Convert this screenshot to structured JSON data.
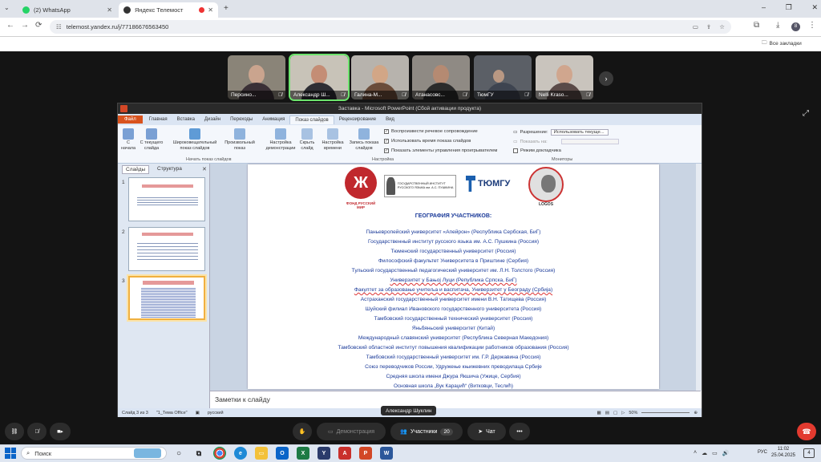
{
  "browser": {
    "tabs": [
      {
        "label": "(2) WhatsApp",
        "active": false
      },
      {
        "label": "Яндекс Телемост",
        "active": true
      }
    ],
    "url": "telemost.yandex.ru/j/77186676563450",
    "bookmarks_label": "Все закладки"
  },
  "meeting": {
    "participants": [
      {
        "name": "Персино...",
        "speaking": false
      },
      {
        "name": "Александр Ш...",
        "speaking": true
      },
      {
        "name": "Галина-М...",
        "speaking": false
      },
      {
        "name": "Атанасовс...",
        "speaking": false
      },
      {
        "name": "ТюмГУ",
        "speaking": false
      },
      {
        "name": "Nelli Kraso...",
        "speaking": false
      }
    ],
    "presenter_label": "Александр Шуклин",
    "controls": {
      "demo_label": "Демонстрация",
      "participants_label": "Участники",
      "participants_count": "20",
      "chat_label": "Чат"
    }
  },
  "ppt": {
    "title": "Заставка - Microsoft PowerPoint (Сбой активации продукта)",
    "tabs": [
      "Файл",
      "Главная",
      "Вставка",
      "Дизайн",
      "Переходы",
      "Анимация",
      "Показ слайдов",
      "Рецензирование",
      "Вид"
    ],
    "active_tab": "Показ слайдов",
    "ribbon": {
      "buttons": [
        {
          "label": "С начала"
        },
        {
          "label": "С текущего слайда"
        },
        {
          "label": "Широковещательный показ слайдов"
        },
        {
          "label": "Произвольный показ"
        },
        {
          "label": "Настройка демонстрации"
        },
        {
          "label": "Скрыть слайд"
        },
        {
          "label": "Настройка времени"
        },
        {
          "label": "Запись показа слайдов"
        }
      ],
      "group_start": "Начать показ слайдов",
      "group_setup": "Настройка",
      "group_monitors": "Мониторы",
      "checks": [
        "Воспроизвести речевое сопровождение",
        "Использовать время показа слайдов",
        "Показать элементы управления проигрывателем"
      ],
      "resolution_label": "Разрешение:",
      "resolution_value": "Использовать текуще...",
      "show_on_label": "Показать на:",
      "presenter_view_label": "Режим докладчика"
    },
    "pane_tabs": [
      "Слайды",
      "Структура"
    ],
    "thumb_numbers": [
      "1",
      "2",
      "3"
    ],
    "notes_placeholder": "Заметки к слайду",
    "status": {
      "slide": "Слайд 3 из 3",
      "theme": "\"1_Тема Office\"",
      "lang": "русский",
      "zoom": "50%"
    }
  },
  "slide": {
    "logos": {
      "fond": "ФОНД РУССКИЙ МИР",
      "pushkin": "ГОСУДАРСТВЕННЫЙ ИНСТИТУТ РУССКОГО ЯЗЫКА им. А.С. ПУШКИНА",
      "tyumgu": "ТЮМГУ",
      "logos": "LOGOS"
    },
    "title": "ГЕОГРАФИЯ УЧАСТНИКОВ:",
    "lines": [
      "Паньевропейский университет «Апейрон» (Республика Сербская, БиГ)",
      "Государственный институт русского языка им. А.С. Пушкина (Россия)",
      "Тюменский государственный университет (Россия)",
      "Философский факультет Университета в Приштине (Сербия)",
      "Тульский государственный педагогический университет им. Л.Н. Толстого (Россия)",
      "Универзитет у Бањој Луци (Република Српска, БиГ)",
      "Факултет за образовање учитеља и васпитача, Универзитет у Београду (Србија)",
      "Астраханский государственный университет имени В.Н. Татищева (Россия)",
      "Шуйский филиал Ивановского государственного университета (Россия)",
      "Тамбовский государственный технический университет (Россия)",
      "Яньбяньский университет (Китай)",
      "Международный славянский университет (Республика Северная Македония)",
      "Тамбовский областной институт повышения квалификации работников образования (Россия)",
      "Тамбовский государственный университет им. Г.Р. Державина (Россия)",
      "Союз переводчиков России, Удружење књижевних преводилаца Србије",
      "Средняя школа имени Джура Якшича (Ужице, Сербия)",
      "Основная школа „Вук Караџић“ (Витковци, Теслић)"
    ]
  },
  "taskbar": {
    "search_label": "Поиск",
    "lang": "РУС",
    "time": "11:02",
    "date": "25.04.2025"
  }
}
